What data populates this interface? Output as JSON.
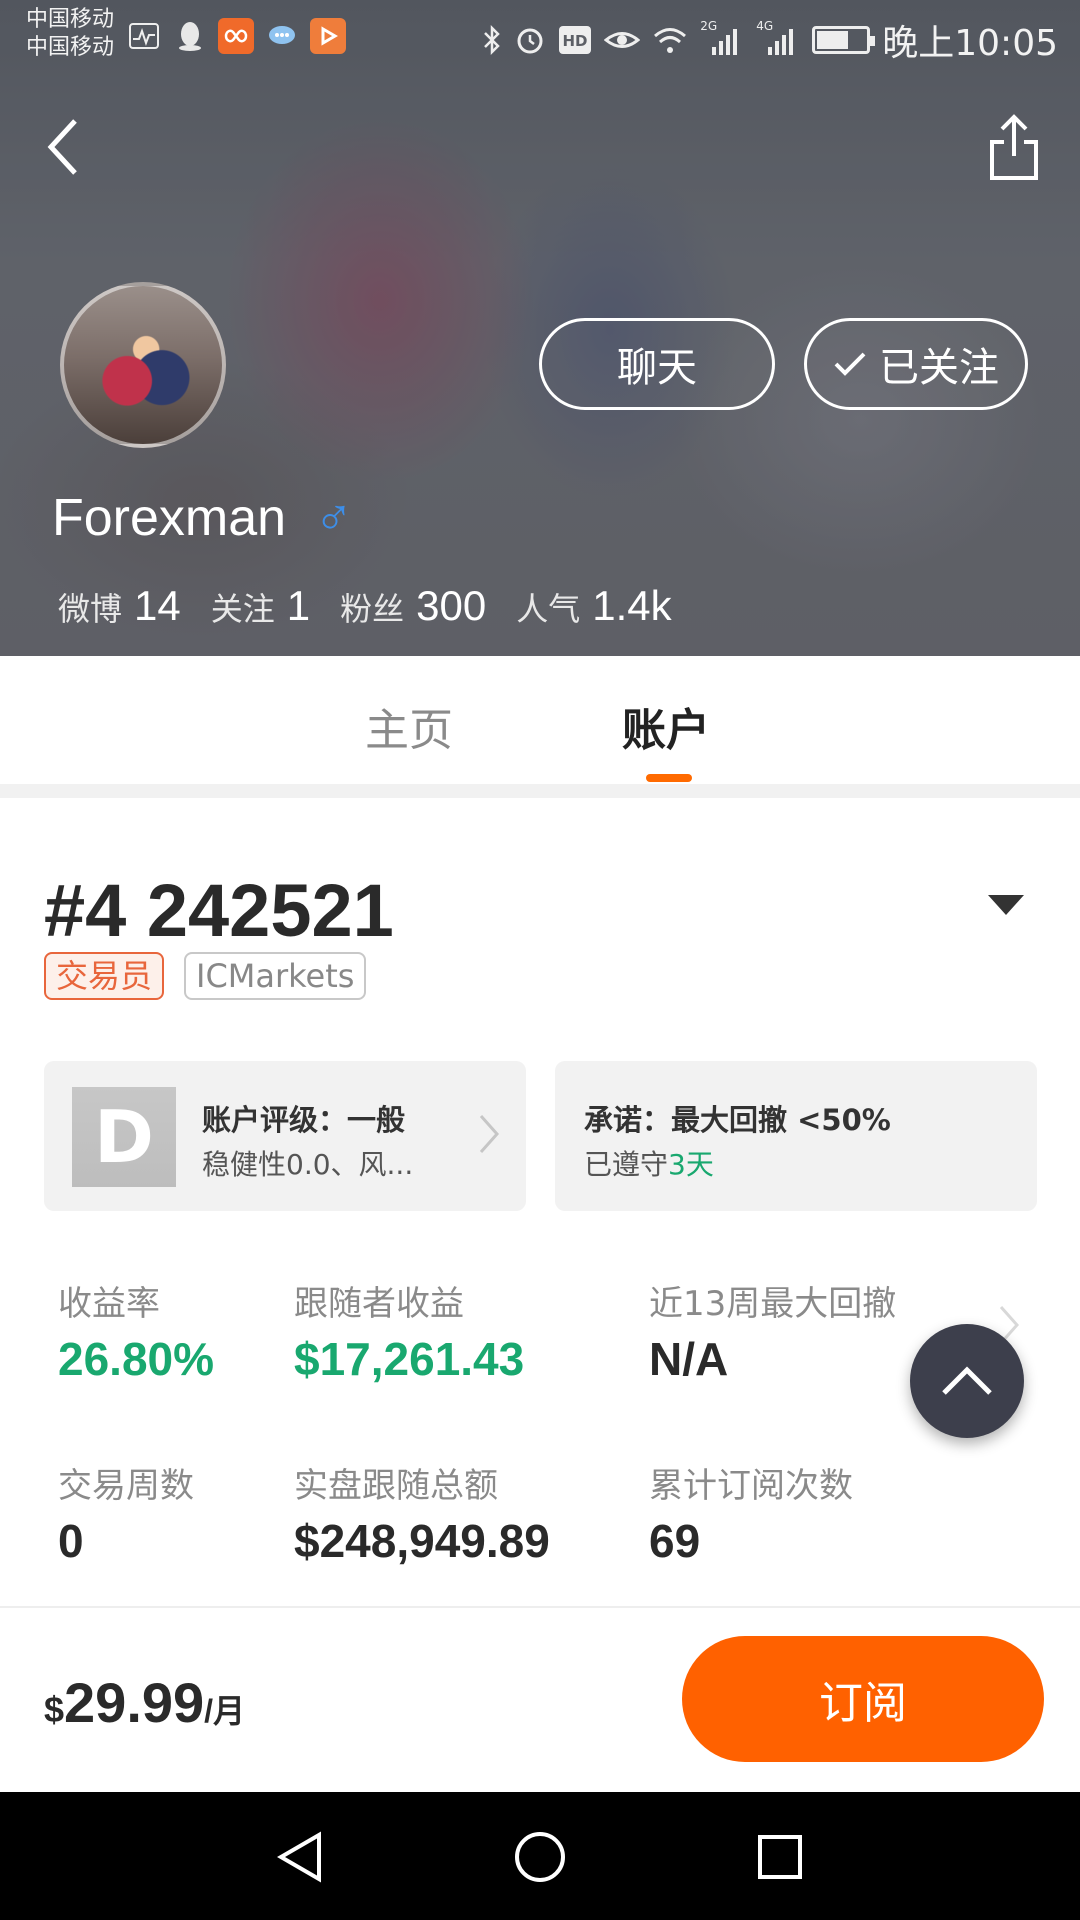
{
  "status_bar": {
    "carrier_line1": "中国移动",
    "carrier_line2": "中国移动",
    "network_1": "2G",
    "network_2": "4G",
    "hd": "HD",
    "time": "晚上10:05",
    "app_icons": [
      "activity-icon",
      "qq-icon",
      "ticket-app-icon",
      "chat-bubble-icon",
      "video-app-icon"
    ],
    "system_icons": [
      "bluetooth-icon",
      "alarm-icon",
      "hd-icon",
      "eye-icon",
      "wifi-icon",
      "signal-icon",
      "signal-icon",
      "battery-icon"
    ]
  },
  "header": {
    "chat_label": "聊天",
    "follow_label": "已关注",
    "username": "Forexman",
    "gender_symbol": "♂",
    "stats": [
      {
        "label": "微博",
        "value": "14"
      },
      {
        "label": "关注",
        "value": "1"
      },
      {
        "label": "粉丝",
        "value": "300"
      },
      {
        "label": "人气",
        "value": "1.4k"
      }
    ]
  },
  "tabs": [
    {
      "label": "主页",
      "active": false
    },
    {
      "label": "账户",
      "active": true
    }
  ],
  "account": {
    "id": "#4 242521",
    "tags": [
      "交易员",
      "ICMarkets"
    ],
    "rating_card": {
      "grade": "D",
      "title": "账户评级：一般",
      "subtitle": "稳健性0.0、风..."
    },
    "promise_card": {
      "title": "承诺：最大回撤 <50%",
      "subtitle_prefix": "已遵守",
      "subtitle_value": "3天"
    },
    "metrics": [
      {
        "label": "收益率",
        "value": "26.80%",
        "highlight": true
      },
      {
        "label": "跟随者收益",
        "value": "$17,261.43",
        "highlight": true
      },
      {
        "label": "近13周最大回撤",
        "value": "N/A",
        "highlight": false
      },
      {
        "label": "交易周数",
        "value": "0",
        "highlight": false
      },
      {
        "label": "实盘跟随总额",
        "value": "$248,949.89",
        "highlight": false
      },
      {
        "label": "累计订阅次数",
        "value": "69",
        "highlight": false
      }
    ]
  },
  "bottom_bar": {
    "currency": "$",
    "price": "29.99",
    "period": "/月",
    "subscribe_label": "订阅"
  },
  "colors": {
    "accent_orange": "#ff6100",
    "profit_green": "#19a86f",
    "fab_dark": "#3d3f4c",
    "gender_blue": "#3d8ee8"
  }
}
